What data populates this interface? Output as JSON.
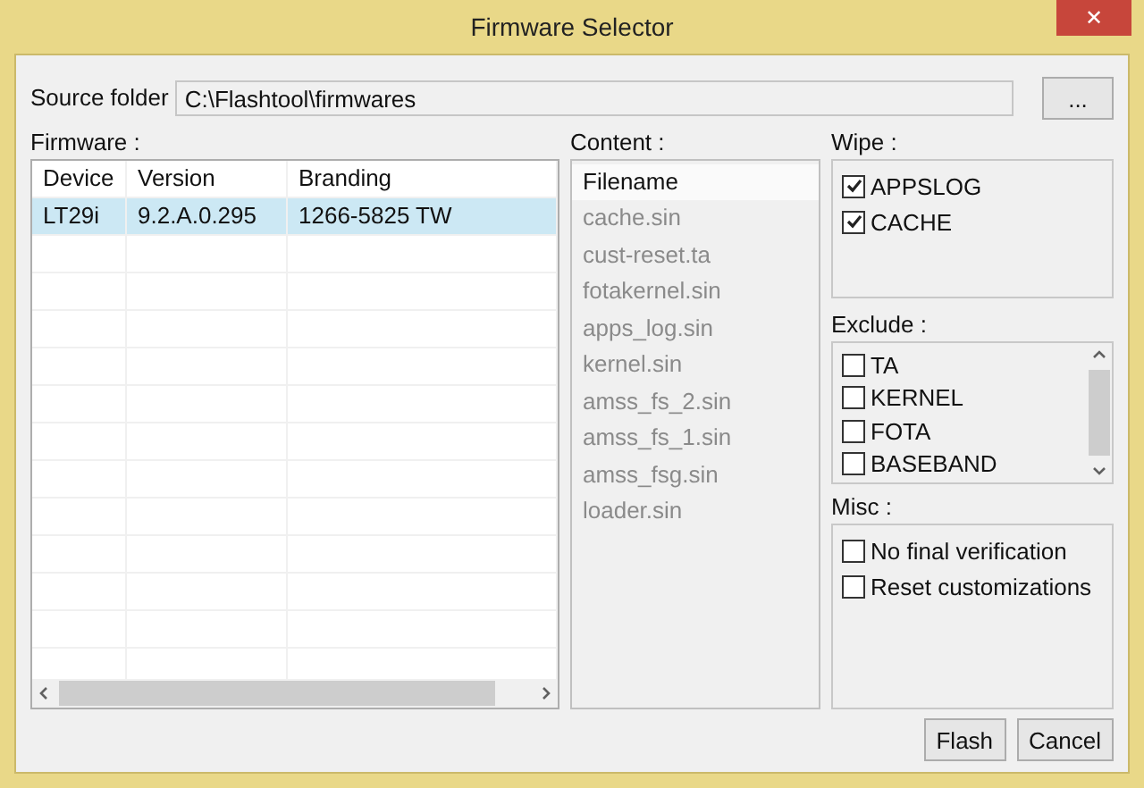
{
  "window": {
    "title": "Firmware Selector",
    "close": "✕"
  },
  "source_folder": {
    "label": "Source folder",
    "value": "C:\\Flashtool\\firmwares",
    "browse": "..."
  },
  "firmware": {
    "label": "Firmware :",
    "columns": [
      "Device",
      "Version",
      "Branding"
    ],
    "rows": [
      {
        "cells": [
          "LT29i",
          "9.2.A.0.295",
          "1266-5825 TW"
        ],
        "selected": true
      }
    ]
  },
  "content": {
    "label": "Content :",
    "header": "Filename",
    "items": [
      "cache.sin",
      "cust-reset.ta",
      "fotakernel.sin",
      "apps_log.sin",
      "kernel.sin",
      "amss_fs_2.sin",
      "amss_fs_1.sin",
      "amss_fsg.sin",
      "loader.sin"
    ]
  },
  "wipe": {
    "label": "Wipe :",
    "items": [
      {
        "label": "APPSLOG",
        "checked": true
      },
      {
        "label": "CACHE",
        "checked": true
      }
    ]
  },
  "exclude": {
    "label": "Exclude :",
    "items": [
      {
        "label": "TA",
        "checked": false
      },
      {
        "label": "KERNEL",
        "checked": false
      },
      {
        "label": "FOTA",
        "checked": false
      },
      {
        "label": "BASEBAND",
        "checked": false
      }
    ]
  },
  "misc": {
    "label": "Misc :",
    "items": [
      {
        "label": "No final verification",
        "checked": false
      },
      {
        "label": "Reset customizations",
        "checked": false
      }
    ]
  },
  "buttons": [
    "Flash",
    "Cancel"
  ]
}
